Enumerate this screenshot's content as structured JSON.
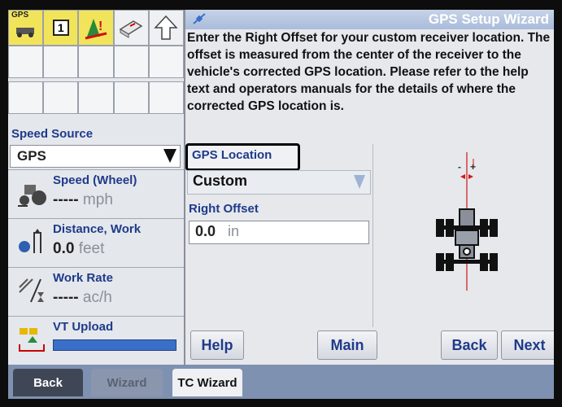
{
  "status_icons": {
    "gps_text": "GPS",
    "slot_text": "1"
  },
  "left": {
    "speed_source": {
      "label": "Speed Source",
      "value": "GPS"
    },
    "speed": {
      "label": "Speed (Wheel)",
      "value": "-----",
      "unit": "mph"
    },
    "distance": {
      "label": "Distance, Work",
      "value": "0.0",
      "unit": "feet"
    },
    "work_rate": {
      "label": "Work Rate",
      "value": "-----",
      "unit": "ac/h"
    },
    "vt_upload": {
      "label": "VT Upload"
    }
  },
  "wizard": {
    "title": "GPS Setup Wizard",
    "instructions": "Enter the Right Offset for your custom receiver location. The offset is measured from the center of the receiver to the vehicle's corrected GPS location. Please refer to the help text and operators manuals for the details of where the corrected GPS location is.",
    "gps_location_label": "GPS Location",
    "gps_location_value": "Custom",
    "right_offset_label": "Right Offset",
    "right_offset_value": "0.0",
    "right_offset_unit": "in",
    "buttons": {
      "help": "Help",
      "main": "Main",
      "back": "Back",
      "next": "Next"
    }
  },
  "tabs": {
    "back": "Back",
    "wizard": "Wizard",
    "tc_wizard": "TC Wizard"
  },
  "colors": {
    "label_blue": "#1f3a8a",
    "bar_blue": "#3a6fc9",
    "tab_bar": "#7f91b1"
  }
}
